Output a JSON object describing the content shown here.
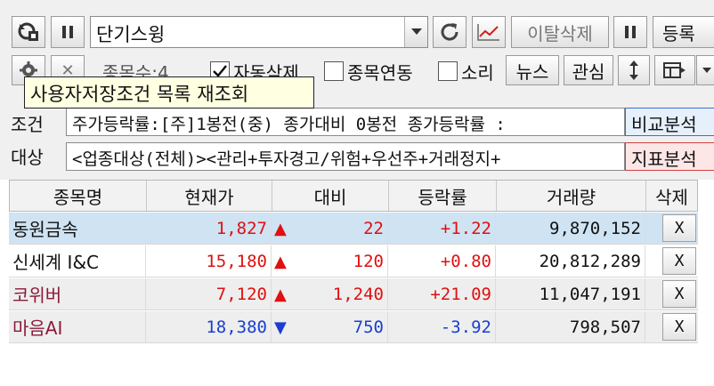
{
  "toolbar": {
    "condition_name": "단기스윙",
    "exit_delete_label": "이탈삭제",
    "register_label": "등록"
  },
  "options": {
    "stock_count_label": "종목수:4",
    "auto_delete_label": "자동삭제",
    "auto_delete_checked": true,
    "link_label": "종목연동",
    "link_checked": false,
    "sound_label": "소리",
    "sound_checked": false,
    "news_label": "뉴스",
    "watch_label": "관심"
  },
  "tooltip": "사용자저장조건 목록 재조회",
  "conditions": {
    "condition_label": "조건",
    "condition_text": "주가등락률:[주]1봉전(중) 종가대비 0봉전 종가등락률 :",
    "compare_label": "비교분석",
    "target_label": "대상",
    "target_text": "<업종대상(전체)><관리+투자경고/위험+우선주+거래정지+",
    "indicator_label": "지표분석"
  },
  "table": {
    "headers": [
      "종목명",
      "현재가",
      "대비",
      "등락률",
      "거래량",
      "삭제"
    ],
    "rows": [
      {
        "name": "동원금속",
        "price": "1,827",
        "dir": "▲",
        "change": "22",
        "rate": "+1.22",
        "volume": "9,870,152",
        "del": "X"
      },
      {
        "name": "신세계 I&C",
        "price": "15,180",
        "dir": "▲",
        "change": "120",
        "rate": "+0.80",
        "volume": "20,812,289",
        "del": "X"
      },
      {
        "name": "코위버",
        "price": "7,120",
        "dir": "▲",
        "change": "1,240",
        "rate": "+21.09",
        "volume": "11,047,191",
        "del": "X"
      },
      {
        "name": "마음AI",
        "price": "18,380",
        "dir": "▼",
        "change": "750",
        "rate": "-3.92",
        "volume": "798,507",
        "del": "X"
      }
    ]
  },
  "colors": {
    "up": "#e01010",
    "down": "#1a3fd0",
    "selected_row": "#cfe3f3",
    "name_dark_red": "#8a1a3a",
    "compare_bg": "#e6f0fc",
    "indicator_bg": "#fde6e6"
  }
}
